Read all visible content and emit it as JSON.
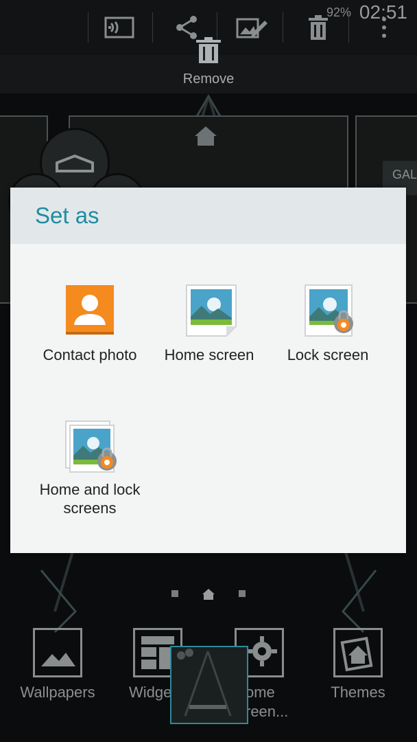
{
  "status_bar": {
    "time": "02:51",
    "battery": "92%"
  },
  "toolbar": {
    "remove_label": "Remove",
    "icons": [
      "cast-icon",
      "share-icon",
      "edit-icon",
      "delete-icon",
      "more-icon"
    ]
  },
  "dialog": {
    "title": "Set as",
    "options": [
      {
        "label": "Contact photo",
        "icon": "contact-icon"
      },
      {
        "label": "Home screen",
        "icon": "home-screen-icon"
      },
      {
        "label": "Lock screen",
        "icon": "lock-screen-icon"
      },
      {
        "label": "Home and lock screens",
        "icon": "home-lock-icon"
      }
    ]
  },
  "bottom_bar": {
    "items": [
      {
        "label": "Wallpapers",
        "icon": "wallpaper-icon"
      },
      {
        "label": "Widge",
        "icon": "widgets-icon"
      },
      {
        "label": "ome\nreen...",
        "icon": "settings-icon"
      },
      {
        "label": "Themes",
        "icon": "themes-icon"
      }
    ]
  },
  "background_text": {
    "gallery_label": "GAL"
  },
  "colors": {
    "accent": "#1f8ca2",
    "contact_orange": "#f58a1f"
  }
}
